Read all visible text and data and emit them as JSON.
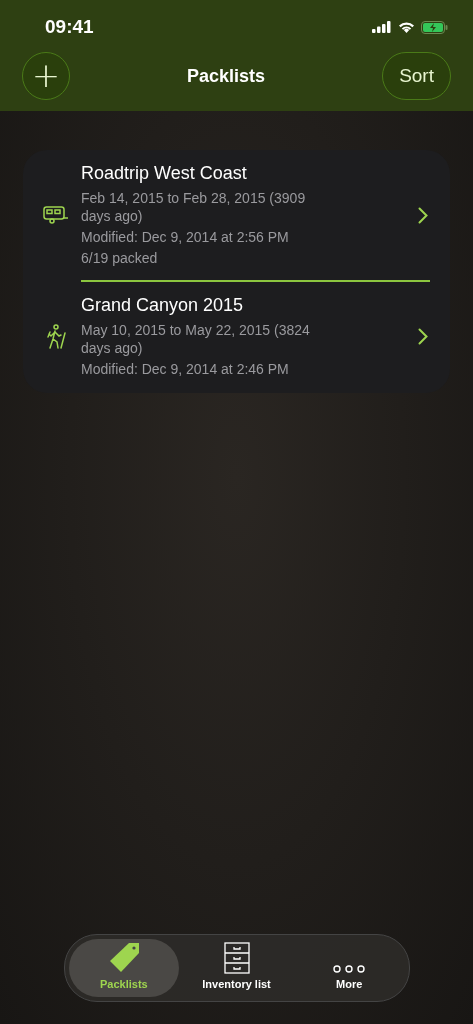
{
  "status_bar": {
    "time": "09:41"
  },
  "nav_bar": {
    "title": "Packlists",
    "add_button": "+",
    "sort_button": "Sort"
  },
  "packlists": [
    {
      "kind": "trailer",
      "title": "Roadtrip West Coast",
      "dates": "Feb 14, 2015 to Feb 28, 2015 (3909 days ago)",
      "modified": "Modified: Dec 9, 2014 at 2:56 PM",
      "packed": "6/19 packed"
    },
    {
      "kind": "hiker",
      "title": "Grand Canyon 2015",
      "dates": "May 10, 2015 to May 22, 2015 (3824 days ago)",
      "modified": "Modified: Dec 9, 2014 at 2:46 PM"
    }
  ],
  "tab_bar": [
    {
      "kind": "tag",
      "label": "Packlists",
      "selected": true
    },
    {
      "kind": "drawers",
      "label": "Inventory list",
      "selected": false
    },
    {
      "kind": "dots",
      "label": "More",
      "selected": false
    }
  ]
}
